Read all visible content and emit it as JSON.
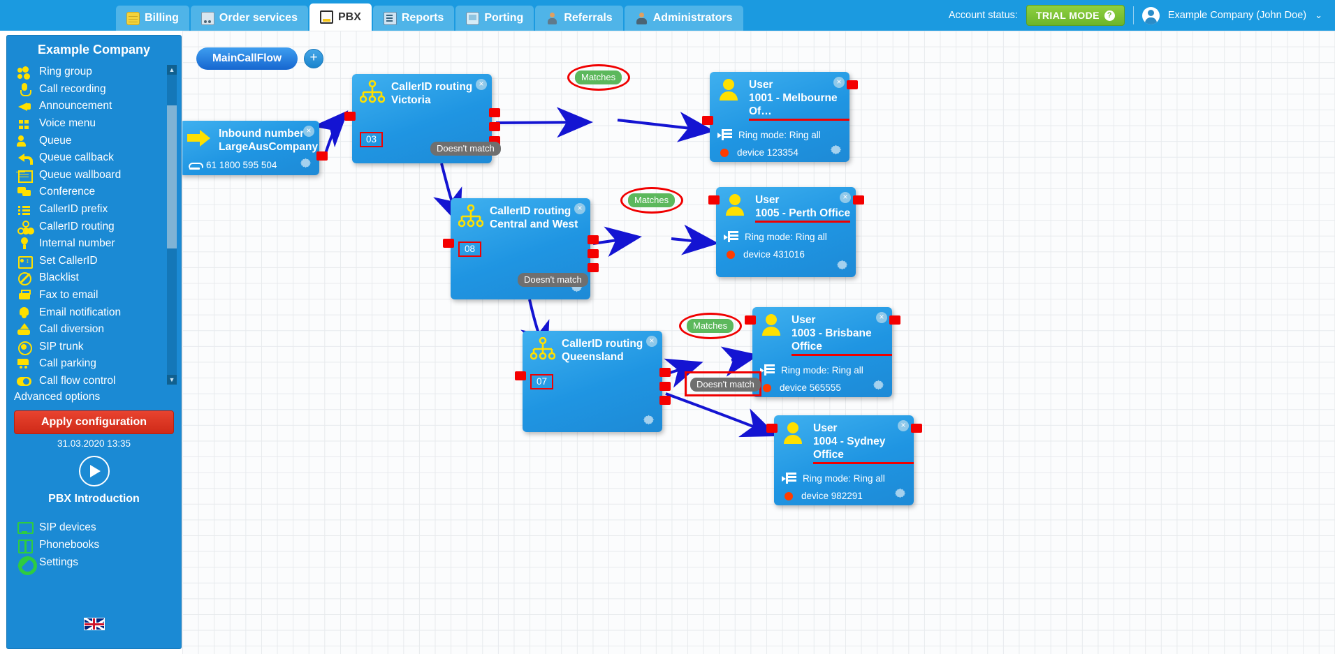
{
  "header": {
    "tabs": [
      {
        "label": "Billing",
        "icon": "coins-icon",
        "icon_class": "ic-coins",
        "active": false
      },
      {
        "label": "Order services",
        "icon": "cart-icon",
        "icon_class": "ic-cart",
        "active": false
      },
      {
        "label": "PBX",
        "icon": "pbx-icon",
        "icon_class": "ic-pbx",
        "active": true
      },
      {
        "label": "Reports",
        "icon": "report-icon",
        "icon_class": "ic-report",
        "active": false
      },
      {
        "label": "Porting",
        "icon": "mobile-phone-icon",
        "icon_class": "ic-phone",
        "active": false
      },
      {
        "label": "Referrals",
        "icon": "person-icon",
        "icon_class": "ic-person",
        "active": false
      },
      {
        "label": "Administrators",
        "icon": "admin-person-icon",
        "icon_class": "ic-admin",
        "active": false
      }
    ],
    "account_status_label": "Account status:",
    "trial_badge": "TRIAL MODE",
    "trial_help": "?",
    "user_name": "Example Company (John Doe)",
    "caret": "⌄"
  },
  "sidebar": {
    "title": "Example Company",
    "items": [
      {
        "label": "Ring group",
        "icon": "ring-group-icon",
        "icon_class": "ring-group"
      },
      {
        "label": "Call recording",
        "icon": "microphone-icon",
        "icon_class": "mic"
      },
      {
        "label": "Announcement",
        "icon": "megaphone-icon",
        "icon_class": "megaphone"
      },
      {
        "label": "Voice menu",
        "icon": "grid-menu-icon",
        "icon_class": "grid4"
      },
      {
        "label": "Queue",
        "icon": "add-user-icon",
        "icon_class": "queue"
      },
      {
        "label": "Queue callback",
        "icon": "arrow-back-icon",
        "icon_class": "arrow-back"
      },
      {
        "label": "Queue wallboard",
        "icon": "table-grid-icon",
        "icon_class": "table"
      },
      {
        "label": "Conference",
        "icon": "chat-bubbles-icon",
        "icon_class": "conf"
      },
      {
        "label": "CallerID prefix",
        "icon": "list-icon",
        "icon_class": "list"
      },
      {
        "label": "CallerID routing",
        "icon": "tree-routing-icon",
        "icon_class": "tree"
      },
      {
        "label": "Internal number",
        "icon": "map-pin-icon",
        "icon_class": "pin"
      },
      {
        "label": "Set CallerID",
        "icon": "id-card-icon",
        "icon_class": "idcard"
      },
      {
        "label": "Blacklist",
        "icon": "block-icon",
        "icon_class": "block"
      },
      {
        "label": "Fax to email",
        "icon": "fax-icon",
        "icon_class": "fax"
      },
      {
        "label": "Email notification",
        "icon": "bell-icon",
        "icon_class": "bell"
      },
      {
        "label": "Call diversion",
        "icon": "upload-arrow-icon",
        "icon_class": "upload"
      },
      {
        "label": "SIP trunk",
        "icon": "sip-trunk-icon",
        "icon_class": "sip"
      },
      {
        "label": "Call parking",
        "icon": "shopping-cart-icon",
        "icon_class": "cart"
      },
      {
        "label": "Call flow control",
        "icon": "toggle-switch-icon",
        "icon_class": "toggle"
      }
    ],
    "advanced_options": "Advanced options",
    "apply_button": "Apply configuration",
    "timestamp": "31.03.2020 13:35",
    "intro_label": "PBX Introduction",
    "play_icon": "play-icon",
    "links": [
      {
        "label": "SIP devices",
        "icon": "monitor-icon",
        "icon_class": "monitor"
      },
      {
        "label": "Phonebooks",
        "icon": "book-icon",
        "icon_class": "book"
      },
      {
        "label": "Settings",
        "icon": "gear-icon",
        "icon_class": "gear"
      }
    ],
    "flag": "uk-flag-icon",
    "scroll_up": "▲",
    "scroll_down": "▼"
  },
  "canvas": {
    "flow_tab": "MainCallFlow",
    "add_flow_icon": "plus-icon",
    "add_flow_label": "+",
    "nodes": [
      {
        "type": "inbound-number",
        "icon": "yellow-arrow-icon",
        "title": "Inbound number",
        "subtitle": "LargeAusCompany",
        "phone": "61 1800 595 504",
        "close": "×",
        "gear": "gear-icon"
      },
      {
        "type": "callerid-routing",
        "icon": "tree-routing-icon",
        "title": "CallerID routing",
        "subtitle": "Victoria",
        "prefix": "03",
        "close": "×",
        "gear": "gear-icon"
      },
      {
        "type": "callerid-routing",
        "icon": "tree-routing-icon",
        "title": "CallerID routing",
        "subtitle": "Central and West",
        "prefix": "08",
        "close": "×",
        "gear": "gear-icon"
      },
      {
        "type": "callerid-routing",
        "icon": "tree-routing-icon",
        "title": "CallerID routing",
        "subtitle": "Queensland",
        "prefix": "07",
        "close": "×",
        "gear": "gear-icon"
      },
      {
        "type": "user",
        "icon": "user-icon",
        "title": "User",
        "subtitle": "1001 - Melbourne Of…",
        "ring_mode": "Ring mode: Ring all",
        "device": "device 123354",
        "close": "×",
        "gear": "gear-icon"
      },
      {
        "type": "user",
        "icon": "user-icon",
        "title": "User",
        "subtitle": "1005 - Perth Office",
        "ring_mode": "Ring mode: Ring all",
        "device": "device 431016",
        "close": "×",
        "gear": "gear-icon"
      },
      {
        "type": "user",
        "icon": "user-icon",
        "title": "User",
        "subtitle": "1003 - Brisbane Office",
        "ring_mode": "Ring mode: Ring all",
        "device": "device 565555",
        "close": "×",
        "gear": "gear-icon"
      },
      {
        "type": "user",
        "icon": "user-icon",
        "title": "User",
        "subtitle": "1004 - Sydney Office",
        "ring_mode": "Ring mode: Ring all",
        "device": "device 982291",
        "close": "×",
        "gear": "gear-icon"
      }
    ],
    "edge_labels": {
      "matches_1": "Matches",
      "matches_2": "Matches",
      "matches_3": "Matches",
      "doesnt_match_1": "Doesn't match",
      "doesnt_match_2": "Doesn't match",
      "doesnt_match_3": "Doesn't match"
    }
  },
  "colors": {
    "brand_blue": "#1b9ae0",
    "sidebar_blue": "#1b8ad4",
    "node_blue": "#1f95e2",
    "accent_yellow": "#ffe000",
    "annotation_red": "#f00000",
    "apply_red": "#d8331f",
    "trial_green": "#7cc234",
    "match_green": "#5cb85c",
    "edge_blue": "#1414d2",
    "port_red": "#f40000",
    "link_green": "#2ecc40"
  }
}
